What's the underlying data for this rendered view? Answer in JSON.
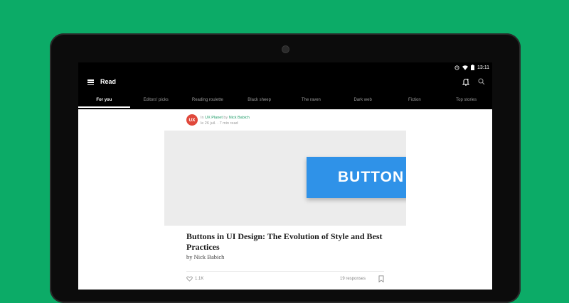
{
  "status": {
    "time": "13:11"
  },
  "appbar": {
    "title": "Read"
  },
  "tabs": [
    {
      "label": "For you"
    },
    {
      "label": "Editors' picks"
    },
    {
      "label": "Reading roulette"
    },
    {
      "label": "Black sheep"
    },
    {
      "label": "The raven"
    },
    {
      "label": "Dark web"
    },
    {
      "label": "Fiction"
    },
    {
      "label": "Top stories"
    }
  ],
  "post": {
    "avatar_text": "UX",
    "in_word": "In",
    "publication": "UX Planet",
    "by_word": "by",
    "author_link": "Nick Babich",
    "date_line": "le 26 juil. · 7 min read",
    "hero_button_label": "BUTTON",
    "title": "Buttons in UI Design: The Evolution of Style and Best Practices",
    "author_line": "by Nick Babich",
    "claps": "1.1K",
    "responses": "19 responses"
  },
  "colors": {
    "background": "#0cab67",
    "accent": "#1f9c68",
    "hero_button": "#2f92e8",
    "avatar": "#e0483b"
  },
  "icons": [
    "menu-icon",
    "bell-icon",
    "search-icon",
    "clap-icon",
    "bookmark-icon",
    "wifi-icon",
    "battery-icon",
    "alarm-icon"
  ]
}
